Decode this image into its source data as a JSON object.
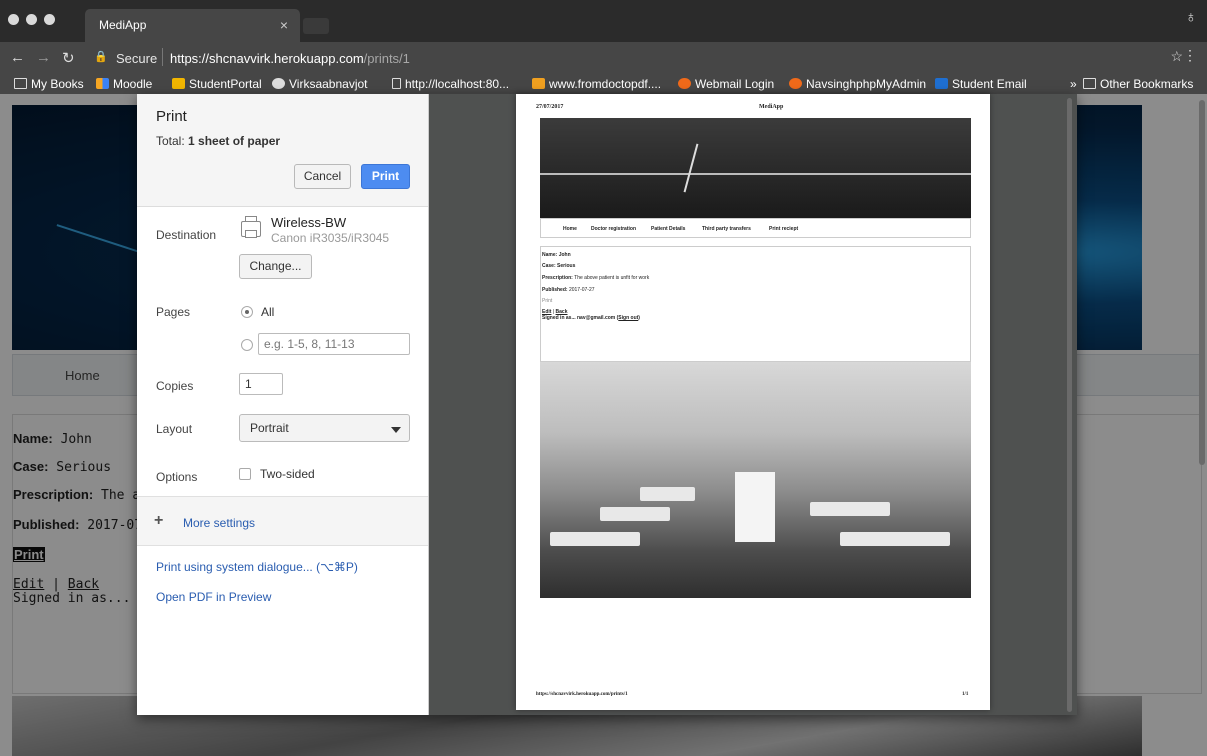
{
  "browser": {
    "tab_title": "MediApp",
    "tab_close": "×",
    "secure_label": "Secure",
    "url_host": "https://shcnavvirk.herokuapp.com",
    "url_path": "/prints/1",
    "bookmarks": [
      "My Books",
      "Moodle",
      "StudentPortal",
      "Virksaabnavjot",
      "http://localhost:80...",
      "www.fromdoctopdf....",
      "Webmail Login",
      "NavsinghphpMyAdmin",
      "Student Email"
    ],
    "bookmarks_overflow": "»",
    "other_bookmarks": "Other Bookmarks"
  },
  "page": {
    "nav_home": "Home",
    "name_label": "Name:",
    "name_value": "John",
    "case_label": "Case:",
    "case_value": "Serious",
    "prescription_label": "Prescription:",
    "prescription_value": "The a",
    "published_label": "Published:",
    "published_value": "2017-07",
    "print_link": "Print",
    "edit_link": "Edit",
    "sep": "|",
    "back_link": "Back",
    "signed_in": "Signed in as... nav@"
  },
  "dialog": {
    "title": "Print",
    "total_label": "Total:",
    "total_value": "1 sheet of paper",
    "cancel": "Cancel",
    "print": "Print",
    "destination_label": "Destination",
    "printer_name": "Wireless-BW",
    "printer_model": "Canon iR3035/iR3045",
    "change": "Change...",
    "pages_label": "Pages",
    "pages_all": "All",
    "pages_placeholder": "e.g. 1-5, 8, 11-13",
    "copies_label": "Copies",
    "copies_value": "1",
    "layout_label": "Layout",
    "layout_value": "Portrait",
    "options_label": "Options",
    "two_sided": "Two-sided",
    "more_settings": "More settings",
    "system_dialog": "Print using system dialogue... (⌥⌘P)",
    "open_pdf": "Open PDF in Preview"
  },
  "preview": {
    "date": "27/07/2017",
    "title": "MediApp",
    "nav": [
      "Home",
      "Doctor registration",
      "Patient Details",
      "Third party transfers",
      "Print reciept"
    ],
    "name_label": "Name:",
    "name_value": "John",
    "case_label": "Case:",
    "case_value": "Serious",
    "prescription_label": "Prescription:",
    "prescription_value": "The above patient is unfit for work",
    "published_label": "Published:",
    "published_value": "2017-07-27",
    "print_text": "Print",
    "edit": "Edit",
    "back": "Back",
    "signed_in": "Signed in as... nav@gmail.com (",
    "sign_out": "Sign out",
    "signed_in_close": ")",
    "footer_url": "https://shcnavvirk.herokuapp.com/prints/1",
    "footer_page": "1/1"
  },
  "colors": {
    "accent": "#4d8cf1",
    "link": "#2a5db0",
    "chrome_dark": "#2b2b2b",
    "chrome_toolbar": "#464646"
  }
}
